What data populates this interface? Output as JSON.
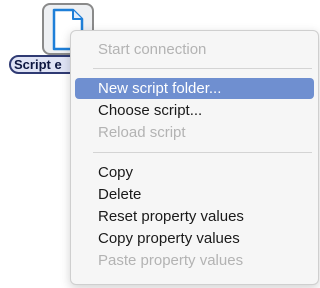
{
  "desktop_icon": {
    "label": "Script e",
    "icon": "document-icon"
  },
  "context_menu": {
    "selected_color": "#6f8fd0",
    "items": [
      {
        "label": "Start connection",
        "enabled": false
      },
      {
        "label": "New script folder...",
        "enabled": true,
        "selected": true
      },
      {
        "label": "Choose script...",
        "enabled": true
      },
      {
        "label": "Reload script",
        "enabled": false
      },
      {
        "label": "Copy",
        "enabled": true
      },
      {
        "label": "Delete",
        "enabled": true
      },
      {
        "label": "Reset property values",
        "enabled": true
      },
      {
        "label": "Copy property values",
        "enabled": true
      },
      {
        "label": "Paste property values",
        "enabled": false
      }
    ]
  }
}
